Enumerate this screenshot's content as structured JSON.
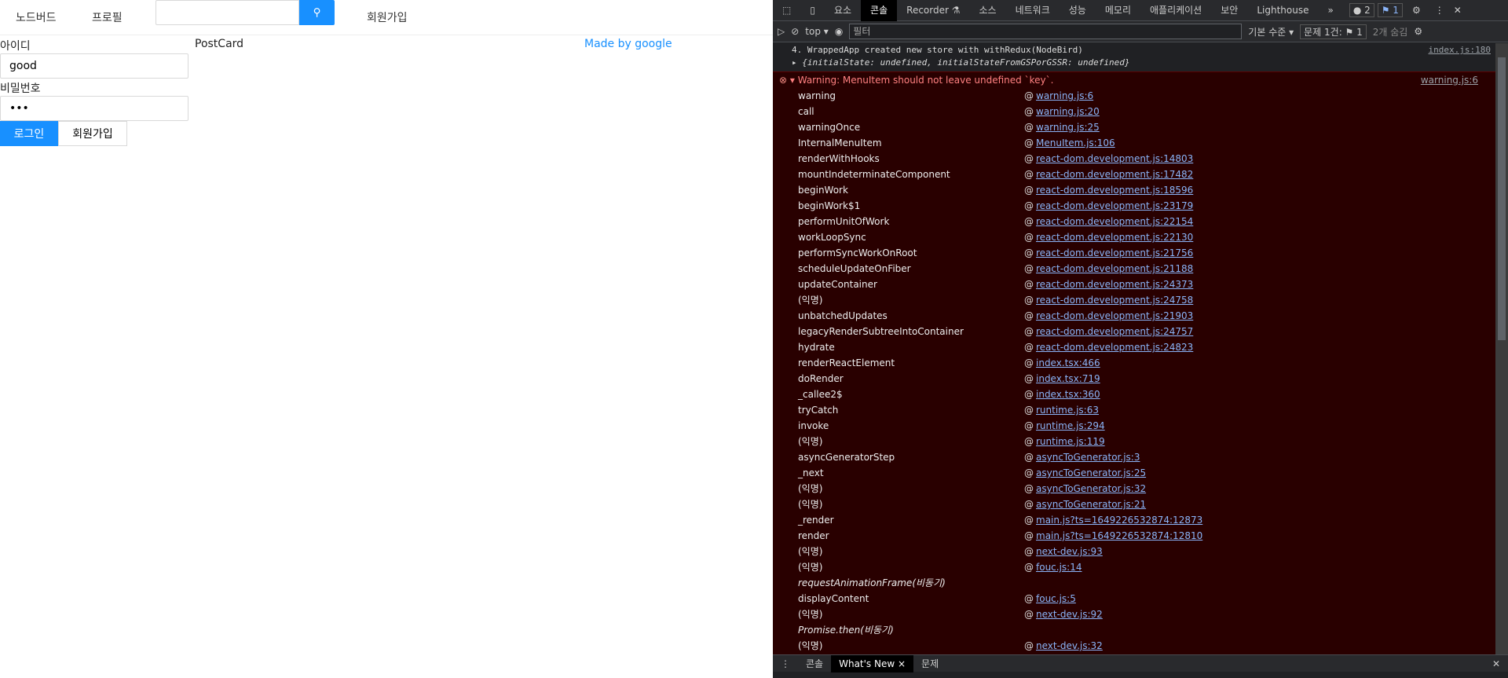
{
  "page": {
    "nav": [
      "노드버드",
      "프로필"
    ],
    "signup_link": "회원가입",
    "search_placeholder": "",
    "id_label": "아이디",
    "id_value": "good",
    "pw_label": "비밀번호",
    "pw_value": "•••",
    "login_button": "로그인",
    "signup_button": "회원가입",
    "postcard": "PostCard",
    "made_by": "Made by google",
    "accent": "#1890ff"
  },
  "devtools": {
    "tabs": [
      "요소",
      "콘솔",
      "Recorder ⚗",
      "소스",
      "네트워크",
      "성능",
      "메모리",
      "애플리케이션",
      "보안",
      "Lighthouse",
      "»"
    ],
    "badges": {
      "errors": "● 2",
      "issues": "⚑ 1"
    },
    "toolbar": {
      "context": "top ▾",
      "filter_placeholder": "필터",
      "level": "기본 수준 ▾",
      "issues": "문제 1건: ⚑ 1",
      "hidden": "2개 숨김"
    },
    "log": {
      "line1": "4. WrappedApp created new store with withRedux(NodeBird)",
      "line1_src": "index.js:180",
      "line2": "▸ {initialState: undefined, initialStateFromGSPorGSSR: undefined}"
    },
    "warning": {
      "text": "▾ Warning: MenuItem should not leave undefined `key`.",
      "src": "warning.js:6"
    },
    "stack": [
      {
        "fn": "warning",
        "src": "warning.js:6"
      },
      {
        "fn": "call",
        "src": "warning.js:20"
      },
      {
        "fn": "warningOnce",
        "src": "warning.js:25"
      },
      {
        "fn": "InternalMenuItem",
        "src": "MenuItem.js:106"
      },
      {
        "fn": "renderWithHooks",
        "src": "react-dom.development.js:14803"
      },
      {
        "fn": "mountIndeterminateComponent",
        "src": "react-dom.development.js:17482"
      },
      {
        "fn": "beginWork",
        "src": "react-dom.development.js:18596"
      },
      {
        "fn": "beginWork$1",
        "src": "react-dom.development.js:23179"
      },
      {
        "fn": "performUnitOfWork",
        "src": "react-dom.development.js:22154"
      },
      {
        "fn": "workLoopSync",
        "src": "react-dom.development.js:22130"
      },
      {
        "fn": "performSyncWorkOnRoot",
        "src": "react-dom.development.js:21756"
      },
      {
        "fn": "scheduleUpdateOnFiber",
        "src": "react-dom.development.js:21188"
      },
      {
        "fn": "updateContainer",
        "src": "react-dom.development.js:24373"
      },
      {
        "fn": "(익명)",
        "src": "react-dom.development.js:24758"
      },
      {
        "fn": "unbatchedUpdates",
        "src": "react-dom.development.js:21903"
      },
      {
        "fn": "legacyRenderSubtreeIntoContainer",
        "src": "react-dom.development.js:24757"
      },
      {
        "fn": "hydrate",
        "src": "react-dom.development.js:24823"
      },
      {
        "fn": "renderReactElement",
        "src": "index.tsx:466"
      },
      {
        "fn": "doRender",
        "src": "index.tsx:719"
      },
      {
        "fn": "_callee2$",
        "src": "index.tsx:360"
      },
      {
        "fn": "tryCatch",
        "src": "runtime.js:63"
      },
      {
        "fn": "invoke",
        "src": "runtime.js:294"
      },
      {
        "fn": "(익명)",
        "src": "runtime.js:119"
      },
      {
        "fn": "asyncGeneratorStep",
        "src": "asyncToGenerator.js:3"
      },
      {
        "fn": "_next",
        "src": "asyncToGenerator.js:25"
      },
      {
        "fn": "(익명)",
        "src": "asyncToGenerator.js:32"
      },
      {
        "fn": "(익명)",
        "src": "asyncToGenerator.js:21"
      },
      {
        "fn": "_render",
        "src": "main.js?ts=1649226532874:12873"
      },
      {
        "fn": "render",
        "src": "main.js?ts=1649226532874:12810"
      },
      {
        "fn": "(익명)",
        "src": "next-dev.js:93"
      },
      {
        "fn": "(익명)",
        "src": "fouc.js:14"
      },
      {
        "fn": "requestAnimationFrame(비동기)",
        "src": "",
        "async": true
      },
      {
        "fn": "displayContent",
        "src": "fouc.js:5"
      },
      {
        "fn": "(익명)",
        "src": "next-dev.js:92"
      },
      {
        "fn": "Promise.then(비동기)",
        "src": "",
        "async": true
      },
      {
        "fn": "(익명)",
        "src": "next-dev.js:32"
      }
    ],
    "drawer": [
      "콘솔",
      "What's New ×",
      "문제"
    ]
  }
}
